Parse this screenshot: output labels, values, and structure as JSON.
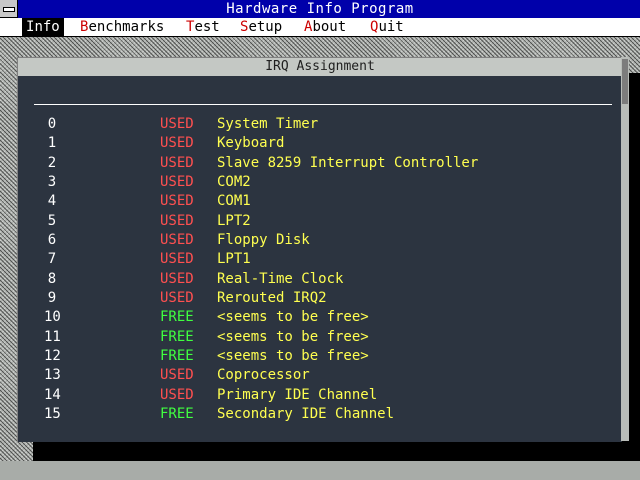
{
  "app": {
    "title": "Hardware Info Program"
  },
  "menu": [
    {
      "accel": "I",
      "rest": "nfo",
      "active": true
    },
    {
      "accel": "B",
      "rest": "enchmarks",
      "active": false
    },
    {
      "accel": "T",
      "rest": "est",
      "active": false
    },
    {
      "accel": "S",
      "rest": "etup",
      "active": false
    },
    {
      "accel": "A",
      "rest": "bout",
      "active": false
    },
    {
      "accel": "Q",
      "rest": "uit",
      "active": false
    }
  ],
  "window": {
    "title": "IRQ Assignment"
  },
  "irqs": [
    {
      "irq": "0",
      "status": "USED",
      "device": "System Timer"
    },
    {
      "irq": "1",
      "status": "USED",
      "device": "Keyboard"
    },
    {
      "irq": "2",
      "status": "USED",
      "device": "Slave 8259 Interrupt Controller"
    },
    {
      "irq": "3",
      "status": "USED",
      "device": "COM2"
    },
    {
      "irq": "4",
      "status": "USED",
      "device": "COM1"
    },
    {
      "irq": "5",
      "status": "USED",
      "device": "LPT2"
    },
    {
      "irq": "6",
      "status": "USED",
      "device": "Floppy Disk"
    },
    {
      "irq": "7",
      "status": "USED",
      "device": "LPT1"
    },
    {
      "irq": "8",
      "status": "USED",
      "device": "Real-Time Clock"
    },
    {
      "irq": "9",
      "status": "USED",
      "device": "Rerouted IRQ2"
    },
    {
      "irq": "10",
      "status": "FREE",
      "device": "<seems to be free>"
    },
    {
      "irq": "11",
      "status": "FREE",
      "device": "<seems to be free>"
    },
    {
      "irq": "12",
      "status": "FREE",
      "device": "<seems to be free>"
    },
    {
      "irq": "13",
      "status": "USED",
      "device": "Coprocessor"
    },
    {
      "irq": "14",
      "status": "USED",
      "device": "Primary IDE Channel"
    },
    {
      "irq": "15",
      "status": "FREE",
      "device": "Secondary IDE Channel"
    }
  ],
  "colors": {
    "titlebar": "#0000aa",
    "window_bg": "#2c3440",
    "used": "#ff5050",
    "free": "#40ff40",
    "device": "#ffff50",
    "accelerator": "#cc0000"
  }
}
